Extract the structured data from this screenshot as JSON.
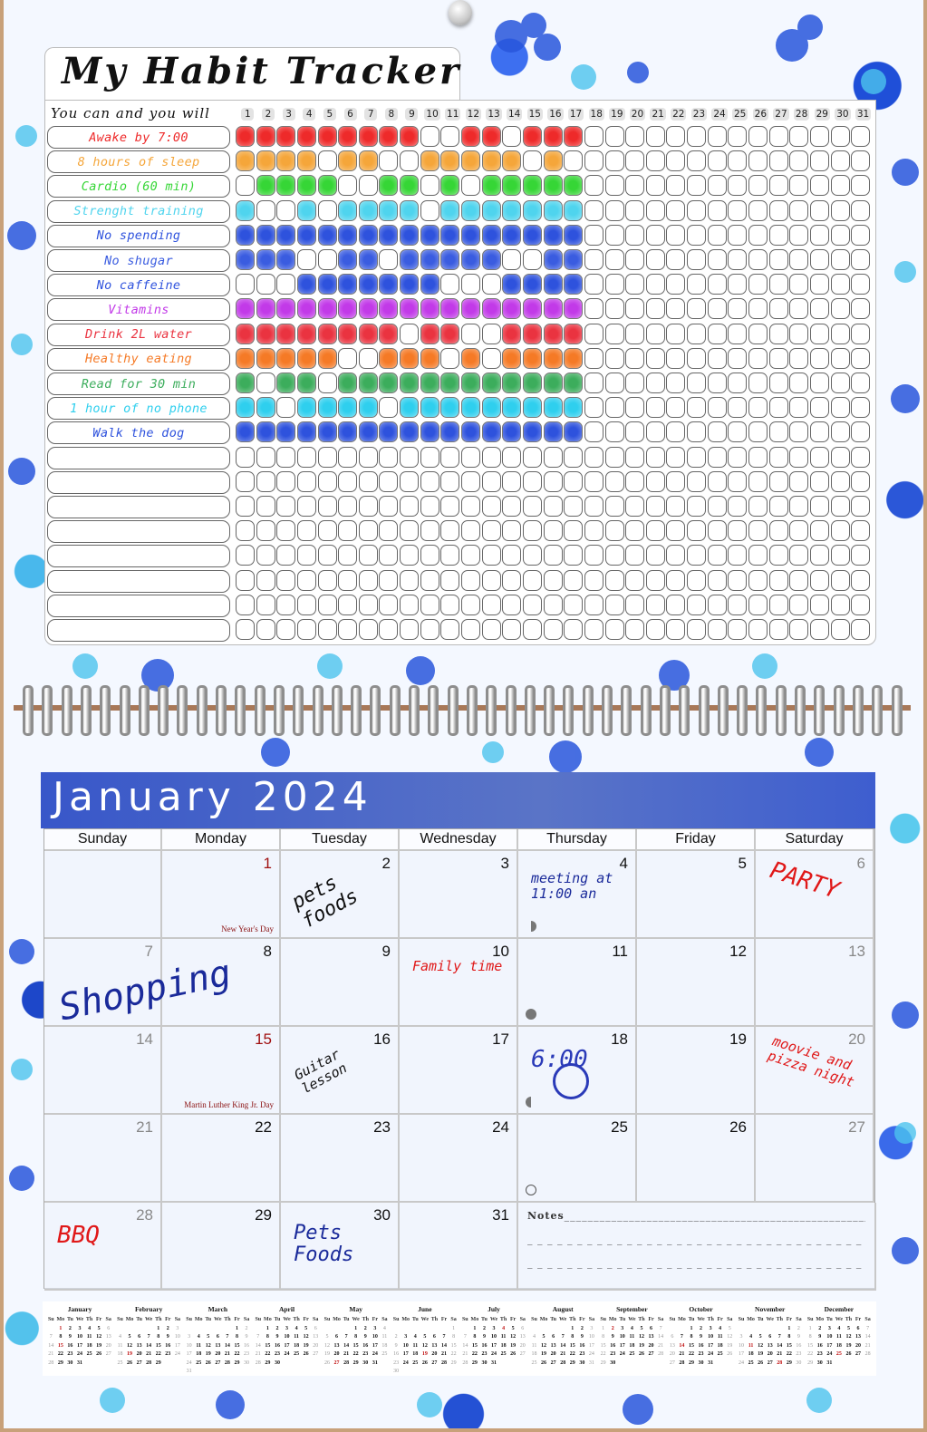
{
  "tracker": {
    "title": "My Habit Tracker",
    "motto": "You can and you will",
    "days": [
      "1",
      "2",
      "3",
      "4",
      "5",
      "6",
      "7",
      "8",
      "9",
      "10",
      "11",
      "12",
      "13",
      "14",
      "15",
      "16",
      "17",
      "18",
      "19",
      "20",
      "21",
      "22",
      "23",
      "24",
      "25",
      "26",
      "27",
      "28",
      "29",
      "30",
      "31"
    ],
    "habits": [
      {
        "label": "Awake by 7:00",
        "color": "#ee2a2a",
        "done": [
          1,
          2,
          3,
          4,
          5,
          6,
          7,
          8,
          9,
          12,
          13,
          15,
          16,
          17
        ]
      },
      {
        "label": "8 hours of sleep",
        "color": "#f5a63a",
        "done": [
          1,
          2,
          3,
          4,
          6,
          7,
          10,
          11,
          12,
          13,
          14,
          16
        ]
      },
      {
        "label": "Cardio (60 min)",
        "color": "#36d636",
        "done": [
          2,
          3,
          4,
          5,
          8,
          9,
          11,
          13,
          14,
          15,
          16,
          17
        ]
      },
      {
        "label": "Strenght training",
        "color": "#4fd4ee",
        "done": [
          1,
          4,
          6,
          7,
          8,
          9,
          11,
          12,
          13,
          14,
          15,
          16,
          17
        ]
      },
      {
        "label": "No spending",
        "color": "#2e52dd",
        "done": [
          1,
          2,
          3,
          4,
          5,
          6,
          7,
          8,
          9,
          10,
          11,
          12,
          13,
          14,
          15,
          16,
          17
        ]
      },
      {
        "label": "No shugar",
        "color": "#3a5ce0",
        "done": [
          1,
          2,
          3,
          6,
          7,
          9,
          10,
          11,
          12,
          13,
          16,
          17
        ]
      },
      {
        "label": "No caffeine",
        "color": "#2e52dd",
        "done": [
          4,
          5,
          6,
          7,
          8,
          9,
          10,
          14,
          15,
          16,
          17
        ]
      },
      {
        "label": "Vitamins",
        "color": "#c23ae8",
        "done": [
          1,
          2,
          3,
          4,
          5,
          6,
          7,
          8,
          9,
          10,
          11,
          12,
          13,
          14,
          15,
          16,
          17
        ]
      },
      {
        "label": "Drink 2L water",
        "color": "#ea3340",
        "done": [
          1,
          2,
          3,
          4,
          5,
          6,
          7,
          8,
          10,
          11,
          14,
          15,
          16,
          17
        ]
      },
      {
        "label": "Healthy eating",
        "color": "#f57a26",
        "done": [
          1,
          2,
          3,
          4,
          5,
          8,
          9,
          10,
          12,
          14,
          15,
          16,
          17
        ]
      },
      {
        "label": "Read for 30 min",
        "color": "#3cad5c",
        "done": [
          1,
          3,
          4,
          6,
          7,
          8,
          9,
          10,
          11,
          12,
          13,
          14,
          15,
          16,
          17
        ]
      },
      {
        "label": "1 hour of no phone",
        "color": "#2fcfee",
        "done": [
          1,
          2,
          4,
          5,
          6,
          7,
          9,
          10,
          11,
          12,
          13,
          14,
          15,
          16,
          17
        ]
      },
      {
        "label": "Walk the dog",
        "color": "#2e52dd",
        "done": [
          1,
          2,
          3,
          4,
          5,
          6,
          7,
          8,
          9,
          10,
          11,
          12,
          13,
          14,
          15,
          16,
          17
        ]
      },
      {
        "label": "",
        "color": "#000000",
        "done": []
      },
      {
        "label": "",
        "color": "#000000",
        "done": []
      },
      {
        "label": "",
        "color": "#000000",
        "done": []
      },
      {
        "label": "",
        "color": "#000000",
        "done": []
      },
      {
        "label": "",
        "color": "#000000",
        "done": []
      },
      {
        "label": "",
        "color": "#000000",
        "done": []
      },
      {
        "label": "",
        "color": "#000000",
        "done": []
      },
      {
        "label": "",
        "color": "#000000",
        "done": []
      }
    ]
  },
  "calendar": {
    "title": "January 2024",
    "weekdays": [
      "Sunday",
      "Monday",
      "Tuesday",
      "Wednesday",
      "Thursday",
      "Friday",
      "Saturday"
    ],
    "first_weekday_index": 1,
    "days_in_month": 31,
    "holidays": {
      "1": "New Year's Day",
      "15": "Martin Luther King Jr. Day"
    },
    "notes_by_day": {
      "2": {
        "text": "pets foods",
        "color": "#111111"
      },
      "4": {
        "text": "meeting at 11:00 an",
        "color": "#1a2a9a"
      },
      "6": {
        "text": "PARTY",
        "color": "#e01818"
      },
      "7": {
        "text": "Shopping",
        "color": "#1a2a9a"
      },
      "10": {
        "text": "Family time",
        "color": "#e01818"
      },
      "16": {
        "text": "Guitar lesson",
        "color": "#111111"
      },
      "18": {
        "text": "6:00",
        "color": "#2a3ab8"
      },
      "20": {
        "text": "moovie and pizza night",
        "color": "#e01818"
      },
      "28": {
        "text": "BBQ",
        "color": "#e01818"
      },
      "30": {
        "text": "Pets Foods",
        "color": "#1a2a9a"
      }
    },
    "moon_phases": {
      "4": "first-quarter",
      "11": "full",
      "18": "last-quarter",
      "25": "new"
    },
    "notes_label": "Notes"
  },
  "year_overview": {
    "weekday_header": [
      "Su",
      "Mo",
      "Tu",
      "We",
      "Th",
      "Fr",
      "Sa"
    ],
    "months": [
      {
        "name": "January",
        "start": 1,
        "days": 31,
        "holidays": [
          1,
          15
        ]
      },
      {
        "name": "February",
        "start": 4,
        "days": 29,
        "holidays": [
          19
        ]
      },
      {
        "name": "March",
        "start": 5,
        "days": 31,
        "holidays": []
      },
      {
        "name": "April",
        "start": 1,
        "days": 30,
        "holidays": []
      },
      {
        "name": "May",
        "start": 3,
        "days": 31,
        "holidays": [
          27
        ]
      },
      {
        "name": "June",
        "start": 6,
        "days": 30,
        "holidays": [
          19
        ]
      },
      {
        "name": "July",
        "start": 1,
        "days": 31,
        "holidays": [
          4
        ]
      },
      {
        "name": "August",
        "start": 4,
        "days": 31,
        "holidays": []
      },
      {
        "name": "September",
        "start": 0,
        "days": 30,
        "holidays": [
          2
        ]
      },
      {
        "name": "October",
        "start": 2,
        "days": 31,
        "holidays": [
          14
        ]
      },
      {
        "name": "November",
        "start": 5,
        "days": 30,
        "holidays": [
          11,
          28
        ]
      },
      {
        "name": "December",
        "start": 0,
        "days": 31,
        "holidays": [
          25
        ]
      }
    ]
  }
}
